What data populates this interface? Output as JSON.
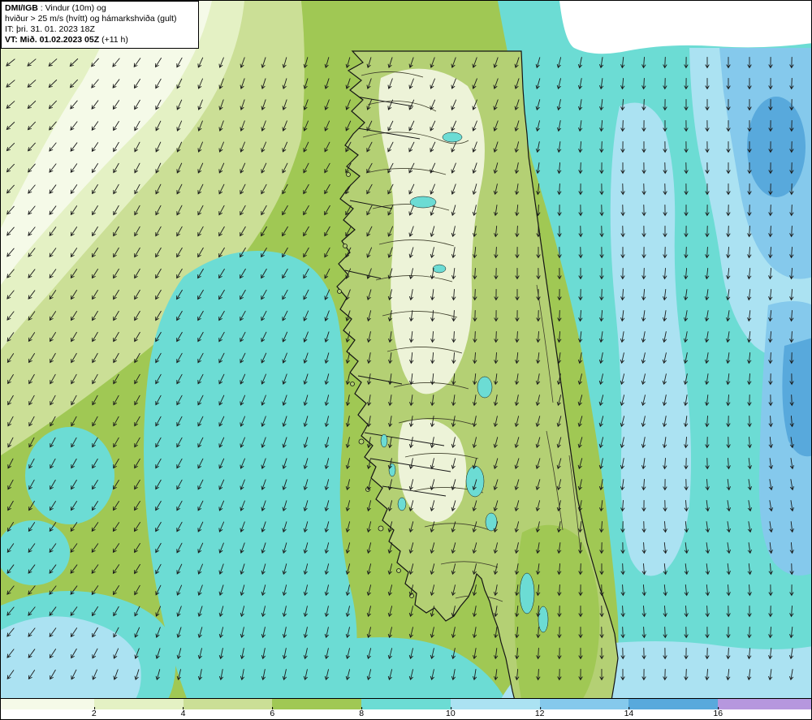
{
  "header": {
    "line1_bold": "DMI/IGB",
    "line1_rest": " : Vindur (10m) og",
    "line2": "hviður > 25 m/s (hvítt) og hámarkshviða (gult)",
    "line3": "IT: þri. 31. 01. 2023 18Z",
    "line4_bold": "VT: Mið. 01.02.2023 05Z",
    "line4_rest": " (+11 h)"
  },
  "legend": {
    "ticks": [
      {
        "label": "2",
        "pos_pct": 11.5
      },
      {
        "label": "4",
        "pos_pct": 22.5
      },
      {
        "label": "6",
        "pos_pct": 33.5
      },
      {
        "label": "8",
        "pos_pct": 44.5
      },
      {
        "label": "10",
        "pos_pct": 55.5
      },
      {
        "label": "12",
        "pos_pct": 66.5
      },
      {
        "label": "14",
        "pos_pct": 77.5
      },
      {
        "label": "16",
        "pos_pct": 88.5
      }
    ],
    "segments": [
      {
        "color": "#f5fae8",
        "width_pct": 11.5
      },
      {
        "color": "#e4f1c4",
        "width_pct": 11
      },
      {
        "color": "#cbdf96",
        "width_pct": 11
      },
      {
        "color": "#a0c854",
        "width_pct": 11
      },
      {
        "color": "#6cdcd4",
        "width_pct": 11
      },
      {
        "color": "#abe2f2",
        "width_pct": 11
      },
      {
        "color": "#85c9ec",
        "width_pct": 11
      },
      {
        "color": "#58a9dc",
        "width_pct": 11
      },
      {
        "color": "#b697de",
        "width_pct": 11.5
      }
    ]
  },
  "map": {
    "bands": {
      "band_0_2": "#f5fae8",
      "band_2_4": "#e4f1c4",
      "band_4_6": "#cbdf96",
      "band_6_8": "#a0c854",
      "band_8_10": "#6cdcd4",
      "band_10_12": "#abe2f2",
      "band_12_14": "#85c9ec",
      "band_14_16": "#58a9dc"
    },
    "land_fill": "#b4d074",
    "highland_fill": "#edf3d8",
    "lake_fill": "#6cdcd4",
    "coastline_color": "#141414",
    "contour_color": "#40402c",
    "arrow_color": "#1a1a1a",
    "gust_region_color": "#ffffff"
  }
}
